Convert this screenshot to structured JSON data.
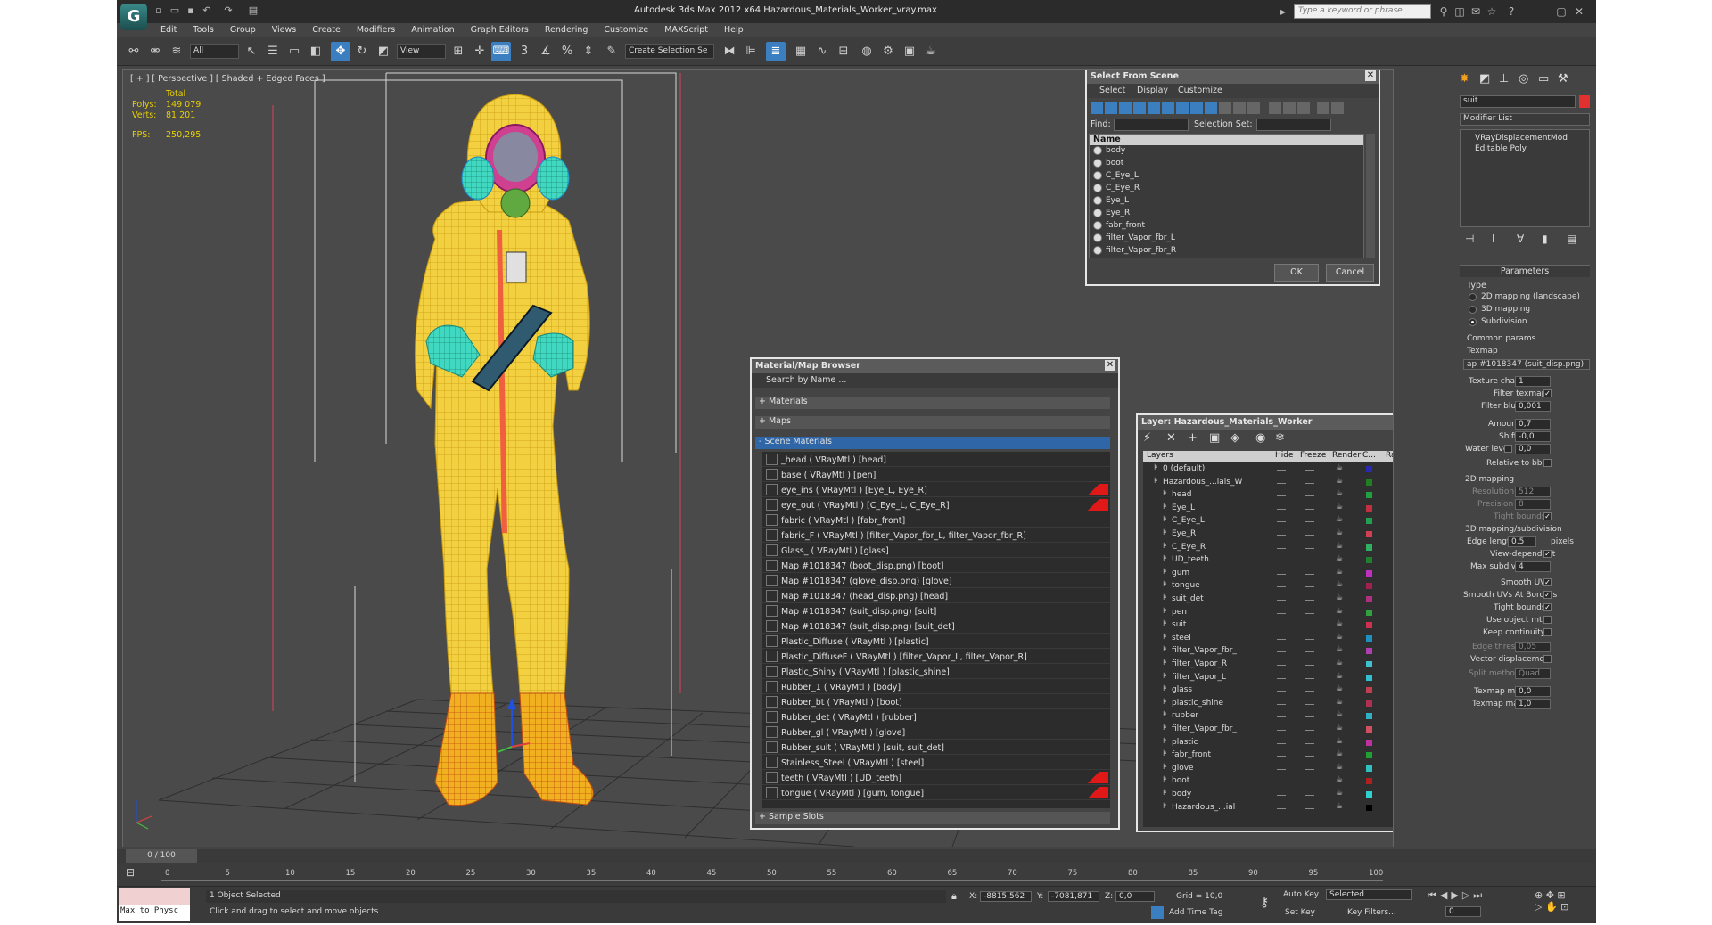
{
  "app": {
    "title": "Autodesk 3ds Max  2012 x64     Hazardous_Materials_Worker_vray.max",
    "search_placeholder": "Type a keyword or phrase",
    "logo_glyph": "G"
  },
  "menu": [
    "Edit",
    "Tools",
    "Group",
    "Views",
    "Create",
    "Modifiers",
    "Animation",
    "Graph Editors",
    "Rendering",
    "Customize",
    "MAXScript",
    "Help"
  ],
  "toolbar": {
    "filter": "All",
    "ref_coord": "View",
    "named_selection": "Create Selection Se",
    "snap_label": "3"
  },
  "viewport": {
    "label": "[ + ] [ Perspective ] [ Shaded + Edged Faces ]",
    "stats": {
      "total": "Total",
      "polys_label": "Polys:",
      "polys": "149 079",
      "verts_label": "Verts:",
      "verts": "81 201",
      "fps_label": "FPS:",
      "fps": "250,295"
    }
  },
  "select_scene": {
    "title": "Select From Scene",
    "tabs": [
      "Select",
      "Display",
      "Customize"
    ],
    "find_label": "Find:",
    "selset_label": "Selection Set:",
    "col_name": "Name",
    "items": [
      "body",
      "boot",
      "C_Eye_L",
      "C_Eye_R",
      "Eye_L",
      "Eye_R",
      "fabr_front",
      "filter_Vapor_fbr_L",
      "filter_Vapor_fbr_R"
    ],
    "ok": "OK",
    "cancel": "Cancel"
  },
  "mat_browser": {
    "title": "Material/Map Browser",
    "search": "Search by Name ...",
    "groups": [
      "+ Materials",
      "+ Maps",
      "- Scene Materials"
    ],
    "sample_slots": "+ Sample Slots",
    "items": [
      {
        "text": "_head  ( VRayMtl )  [head]",
        "flag": false
      },
      {
        "text": "base  ( VRayMtl )  [pen]",
        "flag": false
      },
      {
        "text": "eye_ins  ( VRayMtl )  [Eye_L, Eye_R]",
        "flag": true
      },
      {
        "text": "eye_out  ( VRayMtl )  [C_Eye_L, C_Eye_R]",
        "flag": true
      },
      {
        "text": "fabric  ( VRayMtl )  [fabr_front]",
        "flag": false
      },
      {
        "text": "fabric_F  ( VRayMtl )  [filter_Vapor_fbr_L, filter_Vapor_fbr_R]",
        "flag": false
      },
      {
        "text": "Glass_  ( VRayMtl )  [glass]",
        "flag": false
      },
      {
        "text": "Map #1018347 (boot_disp.png)  [boot]",
        "flag": false
      },
      {
        "text": "Map #1018347 (glove_disp.png)  [glove]",
        "flag": false
      },
      {
        "text": "Map #1018347 (head_disp.png)  [head]",
        "flag": false
      },
      {
        "text": "Map #1018347 (suit_disp.png)  [suit]",
        "flag": false
      },
      {
        "text": "Map #1018347 (suit_disp.png)  [suit_det]",
        "flag": false
      },
      {
        "text": "Plastic_Diffuse  ( VRayMtl )  [plastic]",
        "flag": false
      },
      {
        "text": "Plastic_DiffuseF  ( VRayMtl )  [filter_Vapor_L, filter_Vapor_R]",
        "flag": false
      },
      {
        "text": "Plastic_Shiny  ( VRayMtl )  [plastic_shine]",
        "flag": false
      },
      {
        "text": "Rubber_1  ( VRayMtl )  [body]",
        "flag": false
      },
      {
        "text": "Rubber_bt  ( VRayMtl )  [boot]",
        "flag": false
      },
      {
        "text": "Rubber_det  ( VRayMtl )  [rubber]",
        "flag": false
      },
      {
        "text": "Rubber_gl  ( VRayMtl )  [glove]",
        "flag": false
      },
      {
        "text": "Rubber_suit  ( VRayMtl )  [suit, suit_det]",
        "flag": false
      },
      {
        "text": "Stainless_Steel  ( VRayMtl )  [steel]",
        "flag": false
      },
      {
        "text": "teeth  ( VRayMtl )  [UD_teeth]",
        "flag": true
      },
      {
        "text": "tongue  ( VRayMtl )  [gum, tongue]",
        "flag": true
      }
    ]
  },
  "layer": {
    "title": "Layer: Hazardous_Materials_Worker",
    "cols": [
      "Layers",
      "Hide",
      "Freeze",
      "Render",
      "C...",
      "Radiosity"
    ],
    "rows": [
      {
        "name": "0 (default)",
        "color": "#2a2ab0",
        "top": true
      },
      {
        "name": "Hazardous_...ials_W",
        "color": "#208020",
        "top": true
      },
      {
        "name": "head",
        "color": "#20a040"
      },
      {
        "name": "Eye_L",
        "color": "#c03040"
      },
      {
        "name": "C_Eye_L",
        "color": "#20a050"
      },
      {
        "name": "Eye_R",
        "color": "#d04050"
      },
      {
        "name": "C_Eye_R",
        "color": "#30b060"
      },
      {
        "name": "UD_teeth",
        "color": "#208030"
      },
      {
        "name": "gum",
        "color": "#c030c0"
      },
      {
        "name": "tongue",
        "color": "#a02050"
      },
      {
        "name": "suit_det",
        "color": "#b03080"
      },
      {
        "name": "pen",
        "color": "#30a040"
      },
      {
        "name": "suit",
        "color": "#d03050"
      },
      {
        "name": "steel",
        "color": "#2090c0"
      },
      {
        "name": "filter_Vapor_fbr_",
        "color": "#b040b0"
      },
      {
        "name": "filter_Vapor_R",
        "color": "#40c0d0"
      },
      {
        "name": "filter_Vapor_L",
        "color": "#30c0d0"
      },
      {
        "name": "glass",
        "color": "#c04050"
      },
      {
        "name": "plastic_shine",
        "color": "#b03050"
      },
      {
        "name": "rubber",
        "color": "#30b0c0"
      },
      {
        "name": "filter_Vapor_fbr_",
        "color": "#d05060"
      },
      {
        "name": "plastic",
        "color": "#c030a0"
      },
      {
        "name": "fabr_front",
        "color": "#20a030"
      },
      {
        "name": "glove",
        "color": "#30c0c0"
      },
      {
        "name": "boot",
        "color": "#b02020"
      },
      {
        "name": "body",
        "color": "#30d0d0"
      },
      {
        "name": "Hazardous_...ial",
        "color": "#000000"
      }
    ]
  },
  "cmd": {
    "obj_name": "suit",
    "obj_color": "#e03030",
    "modifier_list": "Modifier List",
    "stack": [
      "VRayDisplacementMod",
      "Editable Poly"
    ],
    "params": "Parameters",
    "type_label": "Type",
    "types": [
      "2D mapping (landscape)",
      "3D mapping",
      "Subdivision"
    ],
    "common": "Common params",
    "texmap_label": "Texmap",
    "texmap": "ap #1018347 (suit_disp.png)",
    "tex_chan": {
      "label": "Texture chan",
      "value": "1"
    },
    "filter_texmap": "Filter texmap",
    "filter_blur": {
      "label": "Filter blur",
      "value": "0,001"
    },
    "amount": {
      "label": "Amount",
      "value": "0,7"
    },
    "shift": {
      "label": "Shift",
      "value": "-0,0"
    },
    "water": {
      "label": "Water level",
      "value": "0,0"
    },
    "relbox": "Relative to bbox",
    "map2d": "2D mapping",
    "resolution": {
      "label": "Resolution",
      "value": "512"
    },
    "precision": {
      "label": "Precision",
      "value": "8"
    },
    "tight1": "Tight bounds",
    "map3d": "3D mapping/subdivision",
    "edge": {
      "label": "Edge length",
      "value": "0,5",
      "unit": "pixels"
    },
    "viewdep": "View-dependent",
    "maxsub": {
      "label": "Max subdivs",
      "value": "4"
    },
    "smoothuv": "Smooth UVs",
    "smoothuvb": "Smooth UVs At Borders",
    "tight2": "Tight bounds",
    "useobj": "Use object mtl",
    "keepcont": "Keep continuity",
    "edgethr": {
      "label": "Edge thresh",
      "value": "0,05"
    },
    "vecdisp": "Vector displacement",
    "split": {
      "label": "Split method",
      "value": "Quad"
    },
    "texmin": {
      "label": "Texmap min",
      "value": "0,0"
    },
    "texmax": {
      "label": "Texmap max",
      "value": "1,0"
    }
  },
  "timeline": {
    "frame": "0 / 100",
    "ticks": [
      "0",
      "5",
      "10",
      "15",
      "20",
      "25",
      "30",
      "35",
      "40",
      "45",
      "50",
      "55",
      "60",
      "65",
      "70",
      "75",
      "80",
      "85",
      "90",
      "95",
      "100"
    ]
  },
  "status": {
    "script": "Max to Physc",
    "selected": "1 Object Selected",
    "prompt": "Click and drag to select and move objects",
    "x": "-8815,562",
    "y": "-7081,871",
    "z": "0,0",
    "x_label": "X:",
    "y_label": "Y:",
    "z_label": "Z:",
    "grid": "Grid = 10,0",
    "add_tag": "Add Time Tag",
    "autokey": "Auto Key",
    "selected_mode": "Selected",
    "setkey": "Set Key",
    "keyfilters": "Key Filters...",
    "frame_field": "0"
  }
}
